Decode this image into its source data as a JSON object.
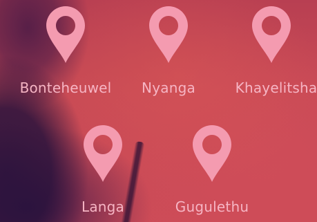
{
  "background": {
    "icon": "map-marker-icon",
    "pin_color": "#f49bb0",
    "label_color": "#f6b5c4"
  },
  "locations": [
    {
      "label": "Bonteheuwel"
    },
    {
      "label": "Nyanga"
    },
    {
      "label": "Khayelitsha"
    },
    {
      "label": "Langa"
    },
    {
      "label": "Gugulethu"
    }
  ]
}
